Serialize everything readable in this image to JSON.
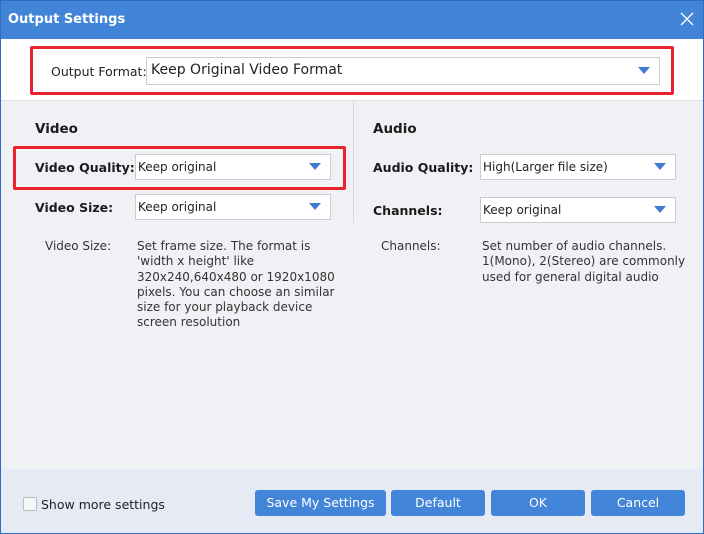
{
  "window": {
    "title": "Output Settings",
    "close_icon": "close-x-icon"
  },
  "output_format": {
    "label": "Output Format:",
    "value": "Keep Original Video Format"
  },
  "video": {
    "heading": "Video",
    "quality": {
      "label": "Video Quality:",
      "value": "Keep original"
    },
    "size": {
      "label": "Video Size:",
      "value": "Keep original"
    },
    "help": {
      "term": "Video Size:",
      "text": "Set frame size. The format is\n'width x height' like\n320x240,640x480 or 1920x1080\npixels. You can choose an similar\nsize for your playback device\nscreen resolution"
    }
  },
  "audio": {
    "heading": "Audio",
    "quality": {
      "label": "Audio Quality:",
      "value": "High(Larger file size)"
    },
    "channels": {
      "label": "Channels:",
      "value": "Keep original"
    },
    "help": {
      "term": "Channels:",
      "text": "Set number of audio channels.\n1(Mono), 2(Stereo) are commonly\nused for general digital audio"
    }
  },
  "footer": {
    "show_more_label": "Show more settings",
    "show_more_checked": false,
    "buttons": {
      "save": "Save My Settings",
      "default": "Default",
      "ok": "OK",
      "cancel": "Cancel"
    }
  },
  "colors": {
    "titlebar": "#4285d8",
    "accent_button": "#4385d9",
    "highlight_box": "#e8232d",
    "dropdown_arrow": "#3d7ad1"
  }
}
